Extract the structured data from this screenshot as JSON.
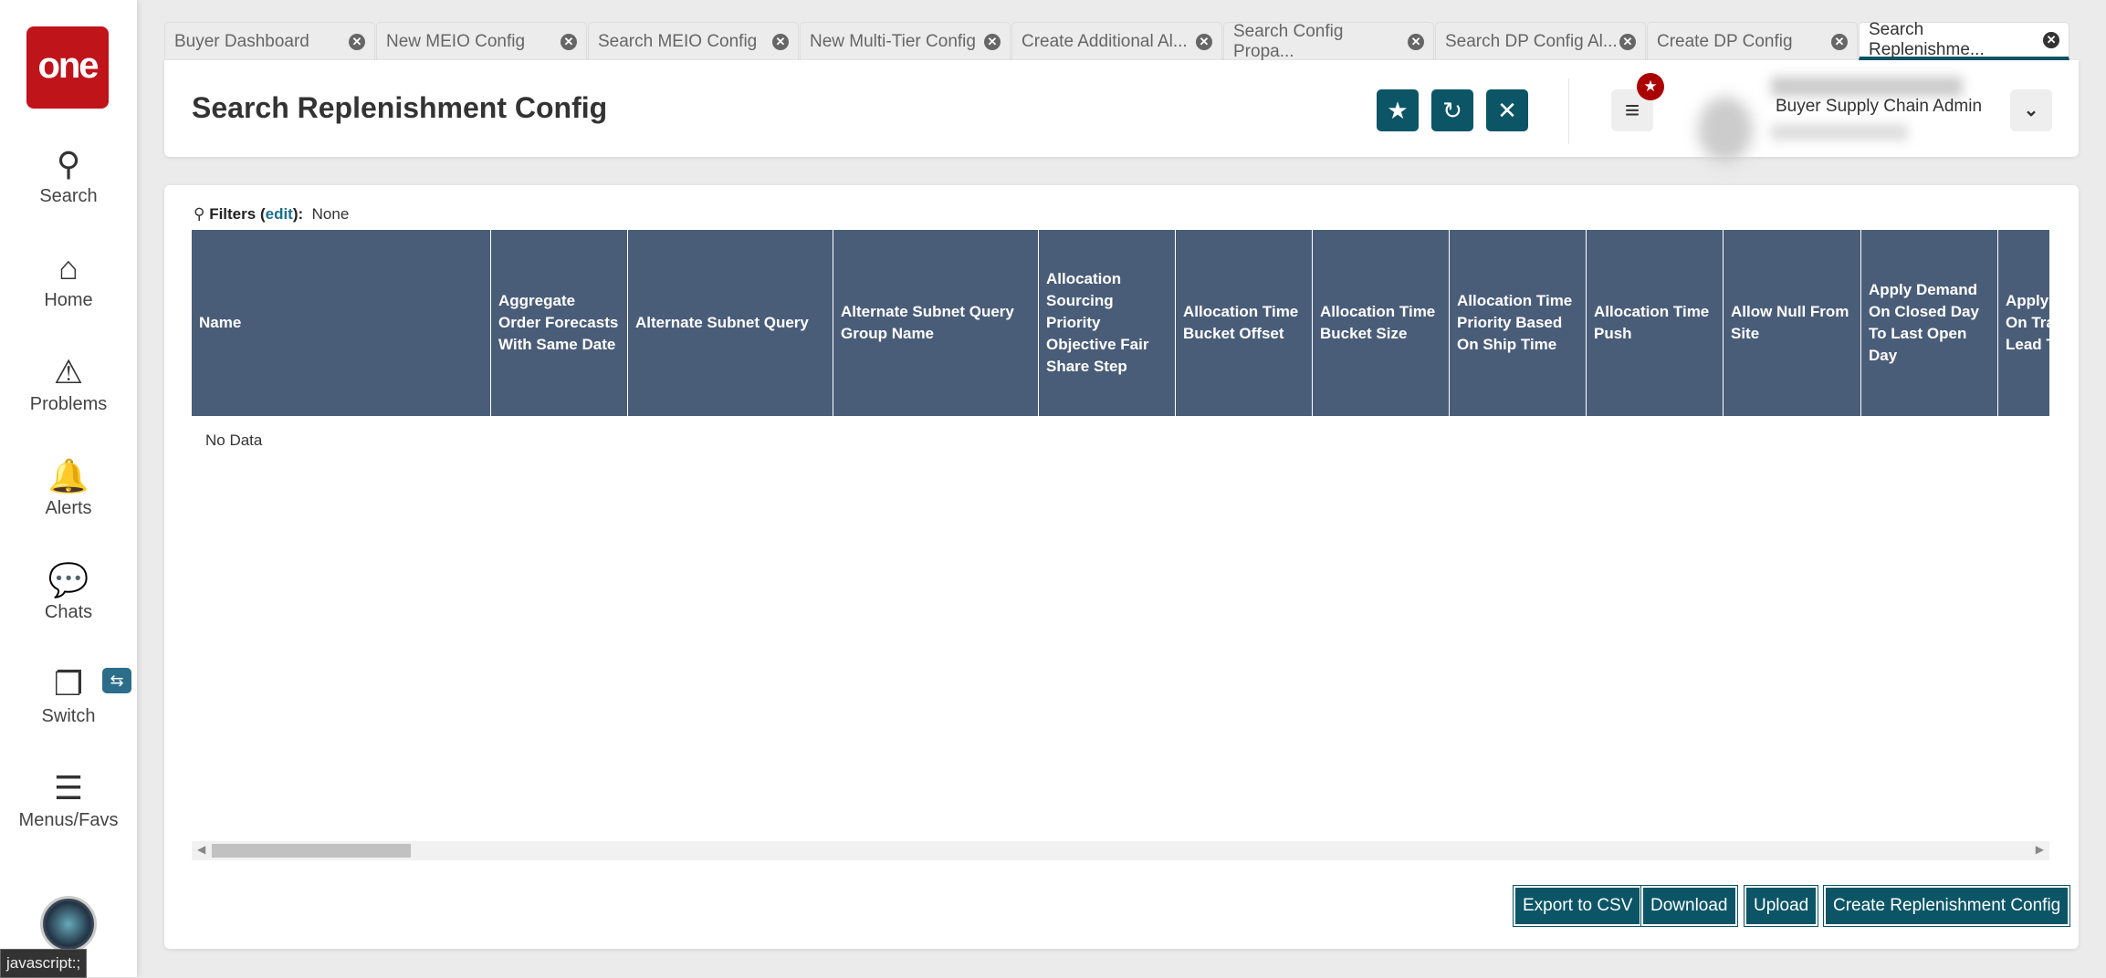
{
  "sidebar": {
    "logo": "one",
    "items": [
      {
        "label": "Search",
        "icon": "search-icon"
      },
      {
        "label": "Home",
        "icon": "home-icon"
      },
      {
        "label": "Problems",
        "icon": "warning-icon"
      },
      {
        "label": "Alerts",
        "icon": "bell-icon"
      },
      {
        "label": "Chats",
        "icon": "chat-icon"
      },
      {
        "label": "Switch",
        "icon": "switch-icon"
      },
      {
        "label": "Menus/Favs",
        "icon": "menu-icon"
      }
    ]
  },
  "status_bar": "javascript:;",
  "tabs": [
    {
      "label": "Buyer Dashboard"
    },
    {
      "label": "New MEIO Config"
    },
    {
      "label": "Search MEIO Config"
    },
    {
      "label": "New Multi-Tier Config"
    },
    {
      "label": "Create Additional Al..."
    },
    {
      "label": "Search Config Propa..."
    },
    {
      "label": "Search DP Config Al..."
    },
    {
      "label": "Create DP Config"
    },
    {
      "label": "Search Replenishme...",
      "active": true
    }
  ],
  "header": {
    "title": "Search Replenishment Config",
    "user_role": "Buyer Supply Chain Admin"
  },
  "filters": {
    "label": "Filters",
    "edit": "edit",
    "value": "None"
  },
  "table": {
    "columns": [
      "Name",
      "Aggregate Order Forecasts With Same Date",
      "Alternate Subnet Query",
      "Alternate Subnet Query Group Name",
      "Allocation Sourcing Priority Objective Fair Share Step",
      "Allocation Time Bucket Offset",
      "Allocation Time Bucket Size",
      "Allocation Time Priority Based On Ship Time",
      "Allocation Time Push",
      "Allow Null From Site",
      "Apply Demand On Closed Day To Last Open Day",
      "Apply Shipment On Transport Lead Time"
    ],
    "empty": "No Data"
  },
  "actions": {
    "export": "Export to CSV",
    "download": "Download",
    "upload": "Upload",
    "create": "Create Replenishment Config"
  }
}
